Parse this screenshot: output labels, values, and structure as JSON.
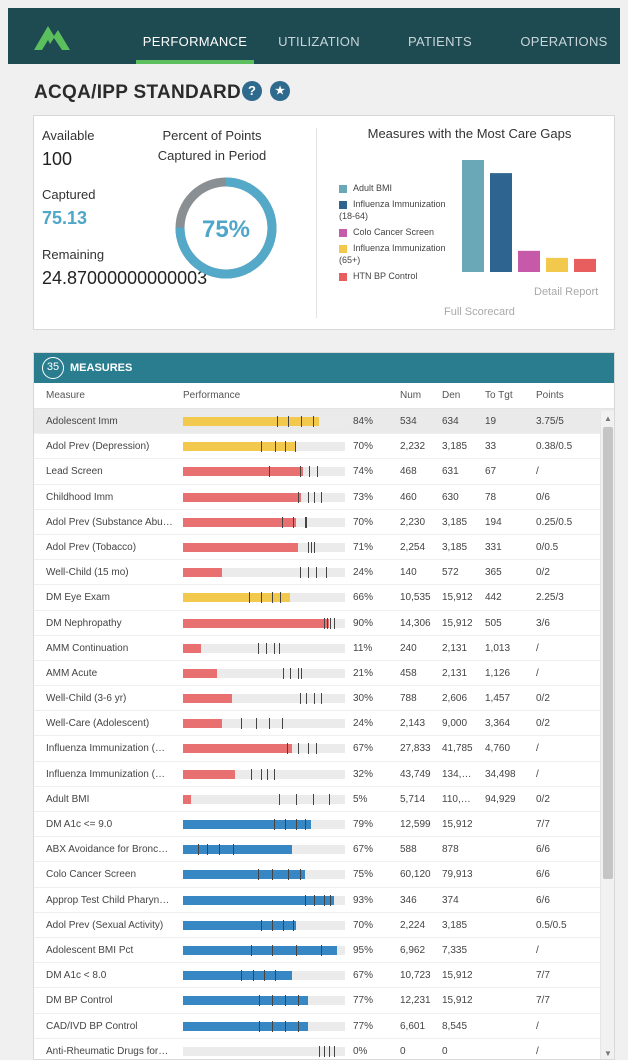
{
  "nav": {
    "tabs": [
      {
        "label": "PERFORMANCE",
        "active": true
      },
      {
        "label": "UTILIZATION",
        "active": false
      },
      {
        "label": "PATIENTS",
        "active": false
      },
      {
        "label": "OPERATIONS",
        "active": false
      }
    ],
    "bg_color": "#1e4a52",
    "active_underline": "#5bbf5e"
  },
  "page": {
    "title": "ACQA/IPP STANDARD",
    "help_icon": "?",
    "star_icon": "★"
  },
  "summary": {
    "available_label": "Available",
    "available_value": "100",
    "captured_label": "Captured",
    "captured_value": "75.13",
    "remaining_label": "Remaining",
    "remaining_value": "24.87000000000003",
    "percent_title": "Percent of Points Captured in Period",
    "percent_value": "75%",
    "percent_fraction": 0.75,
    "gaps_title": "Measures with the Most Care Gaps",
    "legend": [
      {
        "label": "Adult BMI",
        "color": "#6aa8b8"
      },
      {
        "label": "Influenza Immunization (18-64)",
        "color": "#2e6590"
      },
      {
        "label": "Colo Cancer Screen",
        "color": "#c65aa8"
      },
      {
        "label": "Influenza Immunization (65+)",
        "color": "#f2c94c"
      },
      {
        "label": "HTN BP Control",
        "color": "#e85d5d"
      }
    ],
    "gap_bars": [
      111,
      98,
      21,
      14,
      13
    ],
    "full_scorecard": "Full Scorecard",
    "detail_report": "Detail Report"
  },
  "measures": {
    "count": "35",
    "header": "MEASURES",
    "columns": [
      "Measure",
      "Performance",
      "Num",
      "Den",
      "To Tgt",
      "Points"
    ],
    "rows": [
      {
        "name": "Adolescent Imm",
        "pct": "84%",
        "val": 0.84,
        "color": "#f2c94c",
        "ticks": [
          0.58,
          0.65,
          0.73,
          0.8
        ],
        "num": "534",
        "den": "634",
        "tgt": "19",
        "pts": "3.75/5"
      },
      {
        "name": "Adol Prev (Depression)",
        "pct": "70%",
        "val": 0.7,
        "color": "#f2c94c",
        "ticks": [
          0.48,
          0.57,
          0.63,
          0.69
        ],
        "num": "2,232",
        "den": "3,185",
        "tgt": "33",
        "pts": "0.38/0.5"
      },
      {
        "name": "Lead Screen",
        "pct": "74%",
        "val": 0.74,
        "color": "#e87070",
        "ticks": [
          0.53,
          0.72,
          0.78,
          0.83
        ],
        "num": "468",
        "den": "631",
        "tgt": "67",
        "pts": "/"
      },
      {
        "name": "Childhood Imm",
        "pct": "73%",
        "val": 0.73,
        "color": "#e87070",
        "ticks": [
          0.71,
          0.77,
          0.81,
          0.85
        ],
        "num": "460",
        "den": "630",
        "tgt": "78",
        "pts": "0/6"
      },
      {
        "name": "Adol Prev (Substance Abu…",
        "pct": "70%",
        "val": 0.7,
        "color": "#e87070",
        "ticks": [
          0.61,
          0.68,
          0.75,
          0.76
        ],
        "num": "2,230",
        "den": "3,185",
        "tgt": "194",
        "pts": "0.25/0.5"
      },
      {
        "name": "Adol Prev (Tobacco)",
        "pct": "71%",
        "val": 0.71,
        "color": "#e87070",
        "ticks": [
          0.77,
          0.79,
          0.81
        ],
        "num": "2,254",
        "den": "3,185",
        "tgt": "331",
        "pts": "0/0.5"
      },
      {
        "name": "Well-Child (15 mo)",
        "pct": "24%",
        "val": 0.24,
        "color": "#e87070",
        "ticks": [
          0.72,
          0.77,
          0.82,
          0.88
        ],
        "num": "140",
        "den": "572",
        "tgt": "365",
        "pts": "0/2"
      },
      {
        "name": "DM Eye Exam",
        "pct": "66%",
        "val": 0.66,
        "color": "#f2c94c",
        "ticks": [
          0.41,
          0.48,
          0.55,
          0.6
        ],
        "num": "10,535",
        "den": "15,912",
        "tgt": "442",
        "pts": "2.25/3"
      },
      {
        "name": "DM Nephropathy",
        "pct": "90%",
        "val": 0.9,
        "color": "#e87070",
        "ticks": [
          0.87,
          0.89,
          0.91,
          0.93
        ],
        "num": "14,306",
        "den": "15,912",
        "tgt": "505",
        "pts": "3/6"
      },
      {
        "name": "AMM Continuation",
        "pct": "11%",
        "val": 0.11,
        "color": "#e87070",
        "ticks": [
          0.46,
          0.51,
          0.56,
          0.59
        ],
        "num": "240",
        "den": "2,131",
        "tgt": "1,013",
        "pts": "/"
      },
      {
        "name": "AMM Acute",
        "pct": "21%",
        "val": 0.21,
        "color": "#e87070",
        "ticks": [
          0.62,
          0.66,
          0.71,
          0.73
        ],
        "num": "458",
        "den": "2,131",
        "tgt": "1,126",
        "pts": "/"
      },
      {
        "name": "Well-Child (3-6 yr)",
        "pct": "30%",
        "val": 0.3,
        "color": "#e87070",
        "ticks": [
          0.72,
          0.76,
          0.81,
          0.85
        ],
        "num": "788",
        "den": "2,606",
        "tgt": "1,457",
        "pts": "0/2"
      },
      {
        "name": "Well-Care (Adolescent)",
        "pct": "24%",
        "val": 0.24,
        "color": "#e87070",
        "ticks": [
          0.36,
          0.45,
          0.53,
          0.61
        ],
        "num": "2,143",
        "den": "9,000",
        "tgt": "3,364",
        "pts": "0/2"
      },
      {
        "name": "Influenza Immunization (…",
        "pct": "67%",
        "val": 0.67,
        "color": "#e87070",
        "ticks": [
          0.64,
          0.71,
          0.77,
          0.82
        ],
        "num": "27,833",
        "den": "41,785",
        "tgt": "4,760",
        "pts": "/"
      },
      {
        "name": "Influenza Immunization (…",
        "pct": "32%",
        "val": 0.32,
        "color": "#e87070",
        "ticks": [
          0.42,
          0.48,
          0.52,
          0.56
        ],
        "num": "43,749",
        "den": "134,…",
        "tgt": "34,498",
        "pts": "/"
      },
      {
        "name": "Adult BMI",
        "pct": "5%",
        "val": 0.05,
        "color": "#e87070",
        "ticks": [
          0.59,
          0.7,
          0.8,
          0.9
        ],
        "num": "5,714",
        "den": "110,…",
        "tgt": "94,929",
        "pts": "0/2"
      },
      {
        "name": "DM A1c <= 9.0",
        "pct": "79%",
        "val": 0.79,
        "color": "#3787c4",
        "ticks": [
          0.56,
          0.63,
          0.7,
          0.75
        ],
        "num": "12,599",
        "den": "15,912",
        "tgt": "",
        "pts": "7/7"
      },
      {
        "name": "ABX Avoidance for Bronc…",
        "pct": "67%",
        "val": 0.67,
        "color": "#3787c4",
        "ticks": [
          0.09,
          0.15,
          0.22,
          0.31
        ],
        "num": "588",
        "den": "878",
        "tgt": "",
        "pts": "6/6"
      },
      {
        "name": "Colo Cancer Screen",
        "pct": "75%",
        "val": 0.75,
        "color": "#3787c4",
        "ticks": [
          0.46,
          0.55,
          0.65,
          0.72
        ],
        "num": "60,120",
        "den": "79,913",
        "tgt": "",
        "pts": "6/6"
      },
      {
        "name": "Approp Test Child Pharyn…",
        "pct": "93%",
        "val": 0.93,
        "color": "#3787c4",
        "ticks": [
          0.75,
          0.81,
          0.87,
          0.91
        ],
        "num": "346",
        "den": "374",
        "tgt": "",
        "pts": "6/6"
      },
      {
        "name": "Adol Prev (Sexual Activity)",
        "pct": "70%",
        "val": 0.7,
        "color": "#3787c4",
        "ticks": [
          0.48,
          0.55,
          0.62,
          0.68
        ],
        "num": "2,224",
        "den": "3,185",
        "tgt": "",
        "pts": "0.5/0.5"
      },
      {
        "name": "Adolescent BMI Pct",
        "pct": "95%",
        "val": 0.95,
        "color": "#3787c4",
        "ticks": [
          0.42,
          0.55,
          0.7,
          0.85
        ],
        "num": "6,962",
        "den": "7,335",
        "tgt": "",
        "pts": "/"
      },
      {
        "name": "DM A1c < 8.0",
        "pct": "67%",
        "val": 0.67,
        "color": "#3787c4",
        "ticks": [
          0.36,
          0.43,
          0.5,
          0.57
        ],
        "num": "10,723",
        "den": "15,912",
        "tgt": "",
        "pts": "7/7"
      },
      {
        "name": "DM BP Control",
        "pct": "77%",
        "val": 0.77,
        "color": "#3787c4",
        "ticks": [
          0.47,
          0.55,
          0.63,
          0.71
        ],
        "num": "12,231",
        "den": "15,912",
        "tgt": "",
        "pts": "7/7"
      },
      {
        "name": "CAD/IVD BP Control",
        "pct": "77%",
        "val": 0.77,
        "color": "#3787c4",
        "ticks": [
          0.47,
          0.55,
          0.63,
          0.71
        ],
        "num": "6,601",
        "den": "8,545",
        "tgt": "",
        "pts": "/"
      },
      {
        "name": "Anti-Rheumatic Drugs for…",
        "pct": "0%",
        "val": 0.0,
        "color": "#3787c4",
        "ticks": [
          0.84,
          0.87,
          0.9,
          0.93
        ],
        "num": "0",
        "den": "0",
        "tgt": "",
        "pts": "/"
      }
    ]
  }
}
